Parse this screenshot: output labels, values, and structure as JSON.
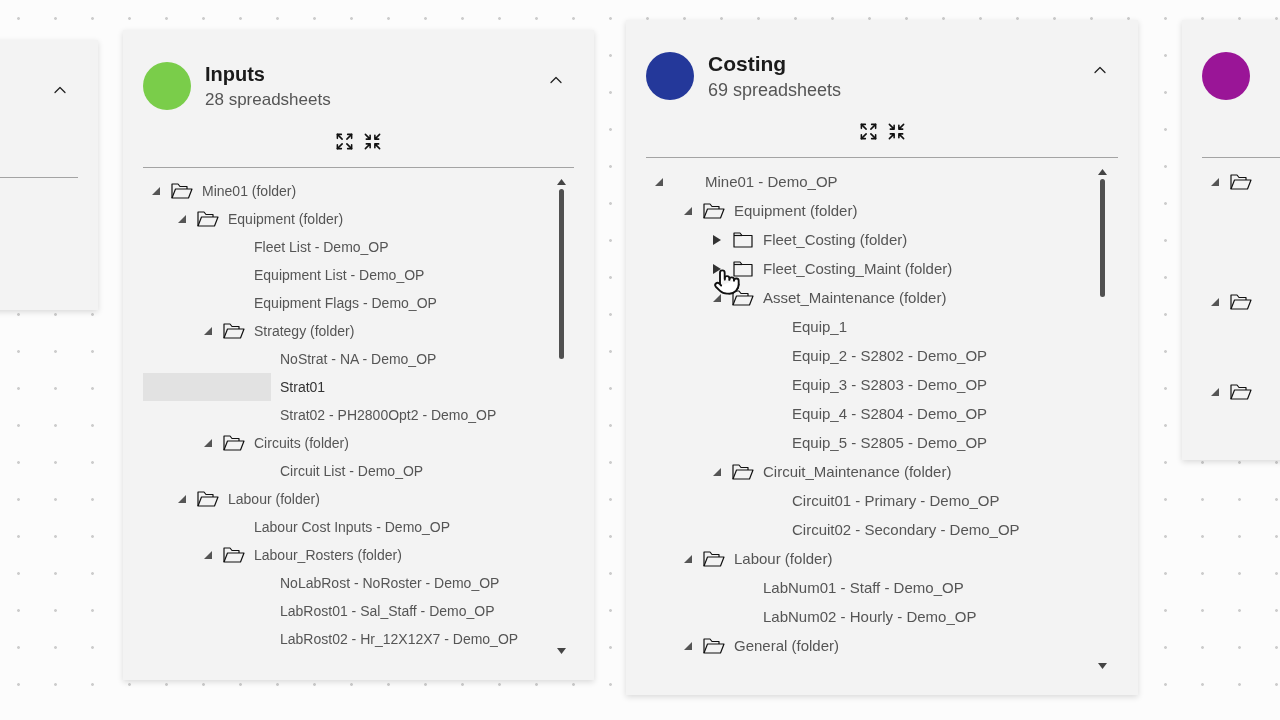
{
  "cards": [
    {
      "expanded": true
    },
    {
      "color": "#7acd4a",
      "title": "Inputs",
      "subtitle": "28 spreadsheets",
      "expanded": true,
      "tree": [
        {
          "kind": "folder",
          "label": "Mine01 (folder)",
          "expanded": true,
          "selected": false,
          "children": [
            {
              "kind": "folder",
              "label": "Equipment (folder)",
              "expanded": true,
              "selected": false,
              "children": [
                {
                  "kind": "sheet",
                  "label": "Fleet List - Demo_OP",
                  "selected": false
                },
                {
                  "kind": "sheet",
                  "label": "Equipment List - Demo_OP",
                  "selected": false
                },
                {
                  "kind": "sheet",
                  "label": "Equipment Flags - Demo_OP",
                  "selected": false
                },
                {
                  "kind": "folder",
                  "label": "Strategy (folder)",
                  "expanded": true,
                  "selected": false,
                  "children": [
                    {
                      "kind": "sheet",
                      "label": "NoStrat - NA - Demo_OP",
                      "selected": false
                    },
                    {
                      "kind": "sheet",
                      "label": "Strat01",
                      "selected": true
                    },
                    {
                      "kind": "sheet",
                      "label": "Strat02 - PH2800Opt2 - Demo_OP",
                      "selected": false
                    }
                  ]
                },
                {
                  "kind": "folder",
                  "label": "Circuits (folder)",
                  "expanded": true,
                  "selected": false,
                  "children": [
                    {
                      "kind": "sheet",
                      "label": "Circuit List - Demo_OP",
                      "selected": false
                    }
                  ]
                }
              ]
            },
            {
              "kind": "folder",
              "label": "Labour (folder)",
              "expanded": true,
              "selected": false,
              "children": [
                {
                  "kind": "sheet",
                  "label": "Labour Cost Inputs - Demo_OP",
                  "selected": false
                },
                {
                  "kind": "folder",
                  "label": "Labour_Rosters (folder)",
                  "expanded": true,
                  "selected": false,
                  "children": [
                    {
                      "kind": "sheet",
                      "label": "NoLabRost - NoRoster - Demo_OP",
                      "selected": false
                    },
                    {
                      "kind": "sheet",
                      "label": "LabRost01 - Sal_Staff - Demo_OP",
                      "selected": false
                    },
                    {
                      "kind": "sheet",
                      "label": "LabRost02 - Hr_12X12X7 - Demo_OP",
                      "selected": false
                    }
                  ]
                }
              ]
            }
          ]
        }
      ]
    },
    {
      "color": "#24389a",
      "title": "Costing",
      "subtitle": "69 spreadsheets",
      "expanded": true,
      "tree": [
        {
          "kind": "group",
          "label": "Mine01 - Demo_OP",
          "expanded": true,
          "selected": false,
          "children": [
            {
              "kind": "folder",
              "label": "Equipment (folder)",
              "expanded": true,
              "selected": false,
              "children": [
                {
                  "kind": "folder",
                  "label": "Fleet_Costing (folder)",
                  "expanded": false,
                  "selected": false
                },
                {
                  "kind": "folder",
                  "label": "Fleet_Costing_Maint (folder)",
                  "expanded": false,
                  "selected": false
                },
                {
                  "kind": "folder",
                  "label": "Asset_Maintenance (folder)",
                  "expanded": true,
                  "selected": false,
                  "children": [
                    {
                      "kind": "sheet",
                      "label": "Equip_1",
                      "selected": false
                    },
                    {
                      "kind": "sheet",
                      "label": "Equip_2 - S2802 - Demo_OP",
                      "selected": false
                    },
                    {
                      "kind": "sheet",
                      "label": "Equip_3 - S2803 - Demo_OP",
                      "selected": false
                    },
                    {
                      "kind": "sheet",
                      "label": "Equip_4 - S2804 - Demo_OP",
                      "selected": false
                    },
                    {
                      "kind": "sheet",
                      "label": "Equip_5 - S2805 - Demo_OP",
                      "selected": false
                    }
                  ]
                },
                {
                  "kind": "folder",
                  "label": "Circuit_Maintenance (folder)",
                  "expanded": true,
                  "selected": false,
                  "children": [
                    {
                      "kind": "sheet",
                      "label": "Circuit01 - Primary - Demo_OP",
                      "selected": false
                    },
                    {
                      "kind": "sheet",
                      "label": "Circuit02 - Secondary - Demo_OP",
                      "selected": false
                    }
                  ]
                }
              ]
            },
            {
              "kind": "folder",
              "label": "Labour (folder)",
              "expanded": true,
              "selected": false,
              "children": [
                {
                  "kind": "sheet",
                  "label": "LabNum01 - Staff - Demo_OP",
                  "selected": false
                },
                {
                  "kind": "sheet",
                  "label": "LabNum02 - Hourly - Demo_OP",
                  "selected": false
                }
              ]
            },
            {
              "kind": "folder",
              "label": "General (folder)",
              "expanded": true,
              "selected": false
            }
          ]
        }
      ]
    },
    {
      "color": "#9a1597",
      "tree": [
        {
          "kind": "folder",
          "expanded": true,
          "children": [
            {
              "kind": "sheet"
            },
            {
              "kind": "sheet"
            },
            {
              "kind": "sheet"
            }
          ]
        },
        {
          "kind": "folder",
          "expanded": true,
          "children": [
            {
              "kind": "sheet"
            },
            {
              "kind": "sheet"
            }
          ]
        },
        {
          "kind": "folder",
          "expanded": true
        }
      ]
    }
  ]
}
